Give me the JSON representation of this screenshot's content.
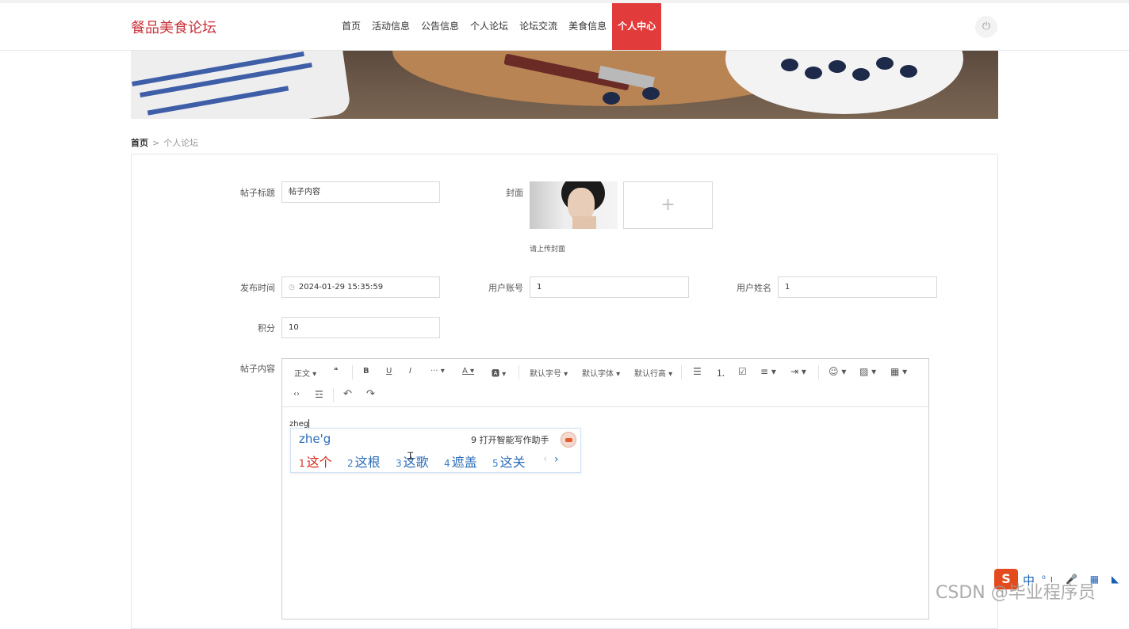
{
  "header": {
    "logo": "餐品美食论坛",
    "nav": [
      {
        "label": "首页"
      },
      {
        "label": "活动信息"
      },
      {
        "label": "公告信息"
      },
      {
        "label": "个人论坛"
      },
      {
        "label": "论坛交流"
      },
      {
        "label": "美食信息"
      },
      {
        "label": "个人中心",
        "active": true
      }
    ],
    "power_icon": "⏻"
  },
  "breadcrumb": {
    "home": "首页",
    "separator": ">",
    "current": "个人论坛"
  },
  "form": {
    "title_label": "帖子标题",
    "title_value": "帖子内容",
    "cover_label": "封面",
    "cover_add": "+",
    "cover_hint": "请上传封面",
    "time_label": "发布时间",
    "time_icon": "◷",
    "time_value": "2024-01-29 15:35:59",
    "account_label": "用户账号",
    "account_value": "1",
    "name_label": "用户姓名",
    "name_value": "1",
    "points_label": "积分",
    "points_value": "10",
    "content_label": "帖子内容"
  },
  "editor": {
    "toolbar_row1": {
      "paragraph": "正文 ▾",
      "quote": "❝",
      "bold": "B",
      "underline": "U",
      "italic": "I",
      "more": "··· ▾",
      "font_color": "A ▾",
      "bg_color": "🅰 ▾",
      "font_size": "默认字号 ▾",
      "font_family": "默认字体 ▾",
      "line_height": "默认行高 ▾",
      "bullet_list": "☰",
      "numbered_list": "⒈",
      "todo": "☑",
      "align": "≡ ▾",
      "indent": "⇥ ▾",
      "emoji": "☺ ▾",
      "image": "▨ ▾",
      "table": "▦ ▾"
    },
    "toolbar_row2": {
      "code": "‹›",
      "divider": "☲",
      "undo": "↶",
      "redo": "↷"
    },
    "content": "zheg"
  },
  "ime": {
    "composition": "zhe'g",
    "assistant": "9 打开智能写作助手",
    "candidates": [
      {
        "num": "1",
        "text": "这个"
      },
      {
        "num": "2",
        "text": "这根"
      },
      {
        "num": "3",
        "text": "这歌"
      },
      {
        "num": "4",
        "text": "遮盖"
      },
      {
        "num": "5",
        "text": "这关"
      }
    ],
    "prev": "‹",
    "next": "›"
  },
  "tray": {
    "sogou": "S",
    "lang": "中",
    "icons": "⁰ı 🎤 ▦ ◣ ▦"
  },
  "watermark": "CSDN @毕业程序员"
}
